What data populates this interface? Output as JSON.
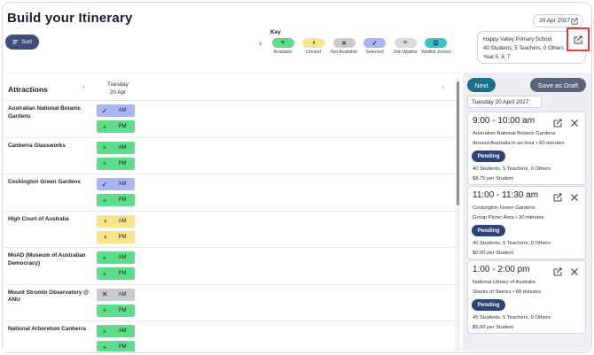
{
  "header": {
    "title": "Build your Itinerary",
    "sort_label": "Sort"
  },
  "key": {
    "title": "Key",
    "items": [
      {
        "label": "Available",
        "icon": "plus-icon",
        "glyph": "+",
        "color": "#5ddc8a"
      },
      {
        "label": "Limited",
        "icon": "half-circle-icon",
        "glyph": "◑",
        "color": "#f7e58b"
      },
      {
        "label": "Not Available",
        "icon": "cross-icon",
        "glyph": "✕",
        "color": "#c9cbd0"
      },
      {
        "label": "Selected",
        "icon": "check-icon",
        "glyph": "✓",
        "color": "#a9b6f0"
      },
      {
        "label": "Join Waitlist",
        "icon": "list-icon",
        "glyph": "≡",
        "color": "#d9dbe0"
      },
      {
        "label": "Waitlist Joined",
        "icon": "list-check-icon",
        "glyph": "☰",
        "color": "#34c6c9"
      }
    ]
  },
  "booking_date": "20 Apr 2027",
  "school": {
    "name": "Happy Valley Primary School",
    "summary": "40 Students, 5 Teachers, 0 Others",
    "year": "Year 5, 6, 7"
  },
  "attractions": {
    "title": "Attractions",
    "day": {
      "weekday": "Tuesday",
      "date": "20 Apr"
    },
    "rows": [
      {
        "name": "Australian National Botanic Gardens",
        "am": {
          "label": "AM",
          "status": "selected"
        },
        "pm": {
          "label": "PM",
          "status": "available"
        }
      },
      {
        "name": "Canberra Glassworks",
        "am": {
          "label": "AM",
          "status": "available"
        },
        "pm": {
          "label": "PM",
          "status": "available"
        }
      },
      {
        "name": "Cockington Green Gardens",
        "am": {
          "label": "AM",
          "status": "selected"
        },
        "pm": {
          "label": "PM",
          "status": "available"
        }
      },
      {
        "name": "High Court of Australia",
        "am": {
          "label": "AM",
          "status": "limited"
        },
        "pm": {
          "label": "PM",
          "status": "limited"
        }
      },
      {
        "name": "MoAD (Museum of Australian Democracy)",
        "am": {
          "label": "AM",
          "status": "available"
        },
        "pm": {
          "label": "PM",
          "status": "available"
        }
      },
      {
        "name": "Mount Stromlo Observatory @ ANU",
        "am": {
          "label": "AM",
          "status": "notavailable"
        },
        "pm": {
          "label": "PM",
          "status": "available"
        }
      },
      {
        "name": "National Arboretum Canberra",
        "am": {
          "label": "AM",
          "status": "available"
        },
        "pm": {
          "label": "PM",
          "status": "available"
        }
      }
    ]
  },
  "itinerary": {
    "next_label": "Next",
    "draft_label": "Save as Draft",
    "day_label": "Tuesday 20 April 2027",
    "bookings": [
      {
        "time": "9:00 - 10:00 am",
        "place": "Australian National Botanic Gardens",
        "program": "Around Australia in an hour • 60 minutes",
        "status": "Pending",
        "people": "40 Students, 5 Teachers, 0 Others",
        "price": "$8.75 per Student"
      },
      {
        "time": "11:00 - 11:30 am",
        "place": "Cockington Green Gardens",
        "program": "Group Picnic Area • 30 minutes",
        "status": "Pending",
        "people": "40 Students, 5 Teachers, 0 Others",
        "price": "$0.00 per Student"
      },
      {
        "time": "1:00 - 2:00 pm",
        "place": "National Library of Australia",
        "program": "Stacks of Stories • 60 minutes",
        "status": "Pending",
        "people": "45 Students, 5 Teachers, 0 Others",
        "price": "$5.00 per Student"
      }
    ]
  },
  "colors": {
    "accent": "#1f6f8a",
    "sort": "#3e4f7d",
    "status_badge": "#2e4477",
    "highlight": "#e43a3a"
  }
}
